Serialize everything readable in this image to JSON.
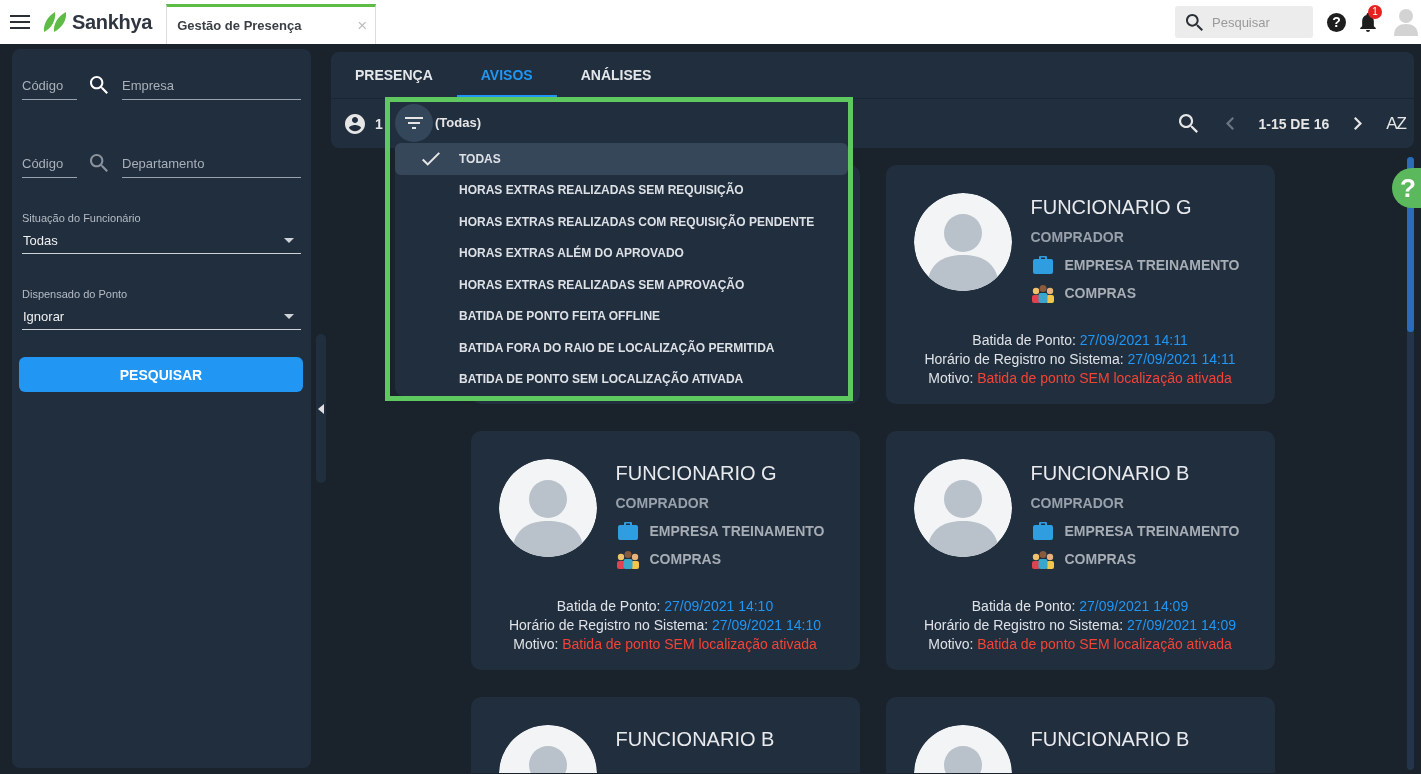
{
  "top_bar": {
    "logo": "Sankhya",
    "tabs": [
      {
        "label": "Gestão de Presença",
        "selected": true,
        "close": "×"
      }
    ],
    "search": {
      "placeholder": "Pesquisar"
    },
    "help": "?",
    "notifications": {
      "badge": "1"
    }
  },
  "filters": {
    "lookups": [
      {
        "code_placeholder": "Código",
        "name_placeholder": "Empresa",
        "disabled": false
      },
      {
        "code_placeholder": "Código",
        "name_placeholder": "Departamento",
        "disabled": true
      }
    ],
    "selects": [
      {
        "label": "Situação do Funcionário",
        "value": "Todas"
      },
      {
        "label": "Dispensado do Ponto",
        "value": "Ignorar"
      }
    ],
    "search_button": "PESQUISAR"
  },
  "tabs": [
    {
      "label": "PRESENÇA",
      "selected": false
    },
    {
      "label": "AVISOS",
      "selected": true
    },
    {
      "label": "ANÁLISES",
      "selected": false
    }
  ],
  "toolbar": {
    "count": "1",
    "filter": "(Todas)",
    "pagination": {
      "range": "1-15 DE 16",
      "previous_disabled": true,
      "next_disabled": false
    },
    "sort": "AZ"
  },
  "filter_menu": {
    "items": [
      {
        "label": "TODAS",
        "selected": true
      },
      {
        "label": "HORAS EXTRAS REALIZADAS SEM REQUISIÇÃO",
        "selected": false
      },
      {
        "label": "HORAS EXTRAS REALIZADAS COM REQUISIÇÃO PENDENTE",
        "selected": false
      },
      {
        "label": "HORAS EXTRAS ALÉM DO APROVADO",
        "selected": false
      },
      {
        "label": "HORAS EXTRAS REALIZADAS SEM APROVAÇÃO",
        "selected": false
      },
      {
        "label": "BATIDA DE PONTO FEITA OFFLINE",
        "selected": false
      },
      {
        "label": "BATIDA FORA DO RAIO DE LOCALIZAÇÃO PERMITIDA",
        "selected": false
      },
      {
        "label": "BATIDA DE PONTO SEM LOCALIZAÇÃO ATIVADA",
        "selected": false
      }
    ]
  },
  "cards": [
    {
      "kind": "covered"
    },
    {
      "kind": "full",
      "name": "FUNCIONARIO G",
      "role": "COMPRADOR",
      "company": "EMPRESA TREINAMENTO",
      "department": "COMPRAS",
      "details": [
        {
          "label": "Batida de Ponto:",
          "value": "27/09/2021 14:11",
          "color": "#2196f3"
        },
        {
          "label": "Horário de Registro no Sistema:",
          "value": "27/09/2021 14:11",
          "color": "#2196f3"
        },
        {
          "label": "Motivo:",
          "value": "Batida de ponto SEM localização ativada",
          "color": "#f44336"
        }
      ]
    },
    {
      "kind": "full",
      "name": "FUNCIONARIO G",
      "role": "COMPRADOR",
      "company": "EMPRESA TREINAMENTO",
      "department": "COMPRAS",
      "details": [
        {
          "label": "Batida de Ponto:",
          "value": "27/09/2021 14:10",
          "color": "#2196f3"
        },
        {
          "label": "Horário de Registro no Sistema:",
          "value": "27/09/2021 14:10",
          "color": "#2196f3"
        },
        {
          "label": "Motivo:",
          "value": "Batida de ponto SEM localização ativada",
          "color": "#f44336"
        }
      ]
    },
    {
      "kind": "full",
      "name": "FUNCIONARIO B",
      "role": "COMPRADOR",
      "company": "EMPRESA TREINAMENTO",
      "department": "COMPRAS",
      "details": [
        {
          "label": "Batida de Ponto:",
          "value": "27/09/2021 14:09",
          "color": "#2196f3"
        },
        {
          "label": "Horário de Registro no Sistema:",
          "value": "27/09/2021 14:09",
          "color": "#2196f3"
        },
        {
          "label": "Motivo:",
          "value": "Batida de ponto SEM localização ativada",
          "color": "#f44336"
        }
      ]
    },
    {
      "kind": "cut",
      "name": "FUNCIONARIO B"
    },
    {
      "kind": "cut",
      "name": "FUNCIONARIO B"
    }
  ],
  "help_tab": "?"
}
